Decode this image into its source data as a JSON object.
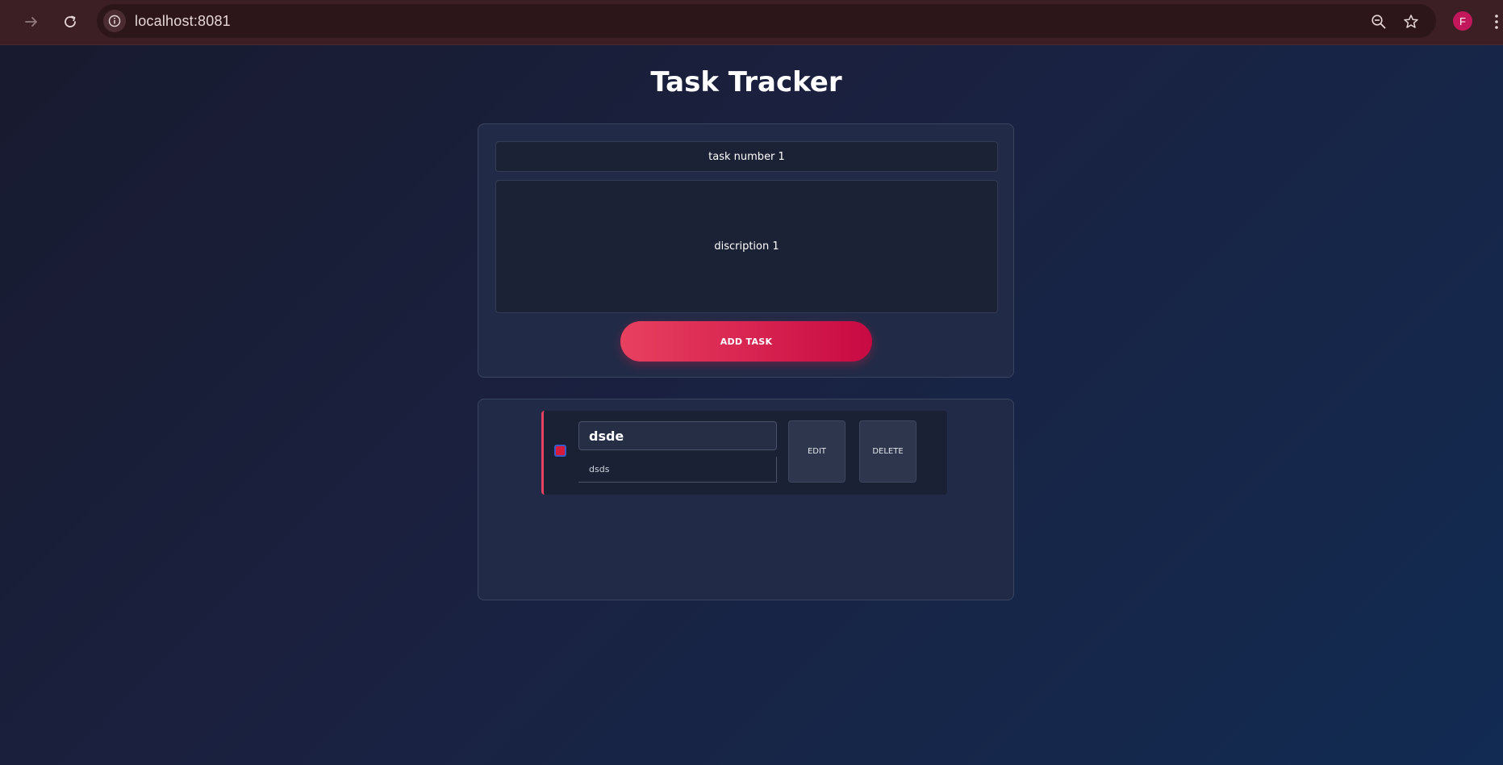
{
  "browser": {
    "url": "localhost:8081",
    "profile_initial": "F",
    "icons": [
      "forward-arrow-icon",
      "reload-icon",
      "info-icon",
      "zoom-out-icon",
      "star-icon",
      "menu-dots-icon"
    ]
  },
  "page": {
    "title": "Task Tracker"
  },
  "form": {
    "title_value": "task number 1",
    "description_value": "discription 1",
    "add_button_label": "ADD TASK"
  },
  "tasks": [
    {
      "title": "dsde",
      "description": "dsds",
      "edit_label": "EDIT",
      "delete_label": "DELETE"
    }
  ],
  "colors": {
    "accent": "#e8405f",
    "accent_dark": "#c80a43",
    "card_bg": "#212b47",
    "chrome_bg": "#3c1f24"
  }
}
